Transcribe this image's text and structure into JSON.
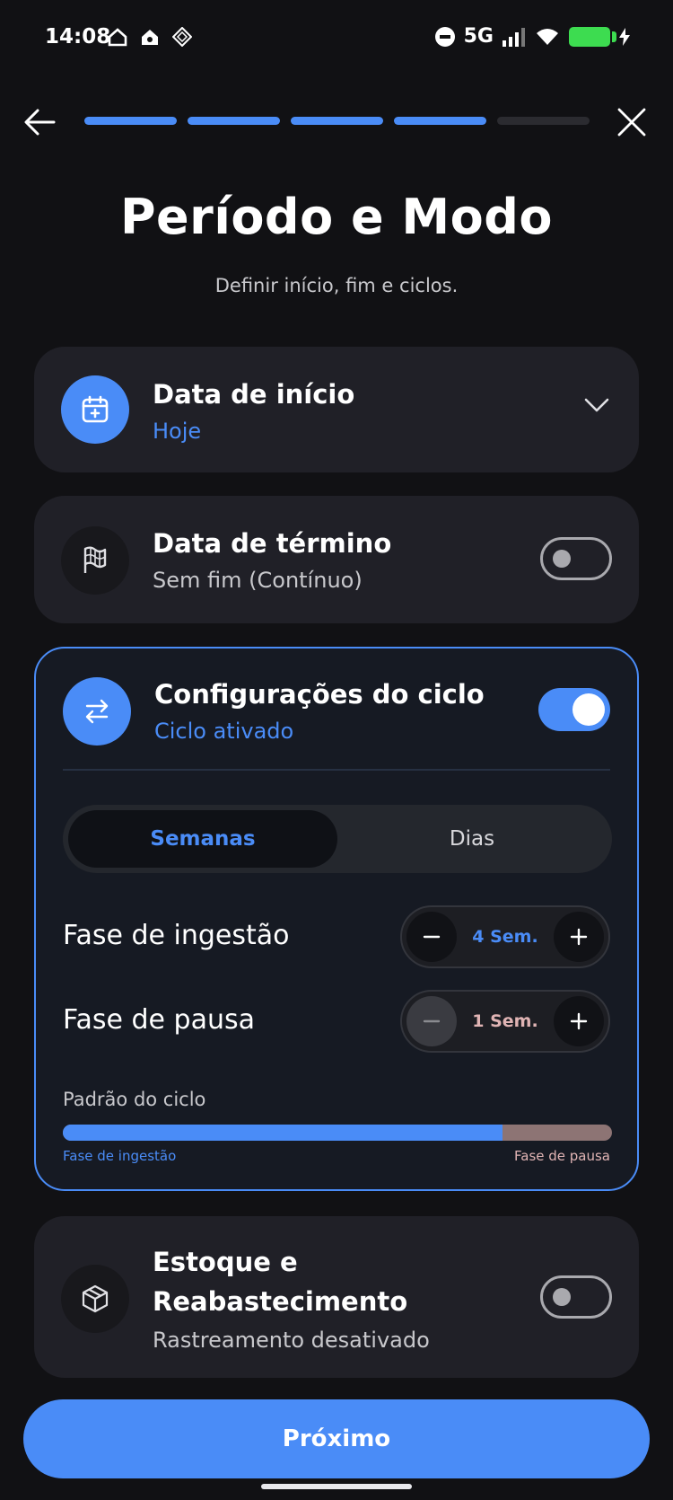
{
  "status_bar": {
    "time": "14:08",
    "network": "5G"
  },
  "nav": {
    "progress_total": 5,
    "progress_completed": 4
  },
  "header": {
    "title": "Período e Modo",
    "subtitle": "Definir início, fim e ciclos."
  },
  "start_date": {
    "title": "Data de início",
    "value": "Hoje"
  },
  "end_date": {
    "title": "Data de término",
    "value": "Sem fim (Contínuo)",
    "enabled": false
  },
  "cycle": {
    "title": "Configurações do ciclo",
    "status": "Ciclo ativado",
    "enabled": true,
    "unit_tabs": [
      "Semanas",
      "Dias"
    ],
    "selected_tab": "Semanas",
    "intake": {
      "label": "Fase de ingestão",
      "value": "4 Sem.",
      "weeks": 4
    },
    "pause": {
      "label": "Fase de pausa",
      "value": "1 Sem.",
      "weeks": 1
    },
    "pattern_label": "Padrão do ciclo",
    "pattern_intake_label": "Fase de ingestão",
    "pattern_pause_label": "Fase de pausa",
    "intake_fraction": 0.8
  },
  "stock": {
    "title_line1": "Estoque e",
    "title_line2": "Reabastecimento",
    "status": "Rastreamento desativado",
    "enabled": false
  },
  "footer": {
    "next_label": "Próximo"
  },
  "colors": {
    "accent": "#4a8cf7",
    "background": "#111114",
    "card": "#202027",
    "pause_bar": "#8d7474",
    "pause_text": "#e0b4b4"
  }
}
